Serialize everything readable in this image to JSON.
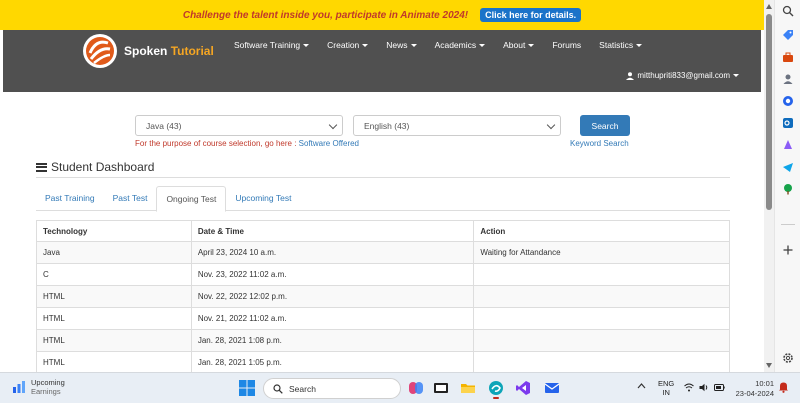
{
  "promo": {
    "text": "Challenge the talent inside you, participate in Animate 2024!",
    "button": "Click here for details."
  },
  "brand": {
    "name_part1": "Spoken",
    "name_part2": "Tutorial"
  },
  "nav": {
    "items": [
      {
        "label": "Software Training",
        "dropdown": true
      },
      {
        "label": "Creation",
        "dropdown": true
      },
      {
        "label": "News",
        "dropdown": true
      },
      {
        "label": "Academics",
        "dropdown": true
      },
      {
        "label": "About",
        "dropdown": true
      },
      {
        "label": "Forums",
        "dropdown": false
      },
      {
        "label": "Statistics",
        "dropdown": true
      }
    ],
    "user_email": "mitthupriti833@gmail.com"
  },
  "search": {
    "foss_value": "Java (43)",
    "language_value": "English (43)",
    "button": "Search",
    "note_prefix": "For the purpose of course selection, go here :",
    "note_link": "Software Offered",
    "keyword_link": "Keyword Search"
  },
  "dashboard": {
    "title": "Student Dashboard",
    "tabs": [
      "Past Training",
      "Past Test",
      "Ongoing Test",
      "Upcoming Test"
    ],
    "active_tab": "Ongoing Test"
  },
  "table": {
    "headers": [
      "Technology",
      "Date & Time",
      "Action"
    ],
    "rows": [
      [
        "Java",
        "April 23, 2024 10 a.m.",
        "Waiting for Attandance"
      ],
      [
        "C",
        "Nov. 23, 2022 11:02 a.m.",
        ""
      ],
      [
        "HTML",
        "Nov. 22, 2022 12:02 p.m.",
        ""
      ],
      [
        "HTML",
        "Nov. 21, 2022 11:02 a.m.",
        ""
      ],
      [
        "HTML",
        "Jan. 28, 2021 1:08 p.m.",
        ""
      ],
      [
        "HTML",
        "Jan. 28, 2021 1:05 p.m.",
        ""
      ]
    ]
  },
  "taskbar": {
    "weather_title": "Upcoming",
    "weather_sub": "Earnings",
    "search_placeholder": "Search",
    "lang_line1": "ENG",
    "lang_line2": "IN",
    "time": "10:01",
    "date": "23-04-2024"
  },
  "colors": {
    "promo_bg": "#ffd800",
    "promo_text": "#c0392b",
    "nav_bg": "#505050",
    "brand_accent": "#f5a623",
    "primary": "#337ab7"
  }
}
